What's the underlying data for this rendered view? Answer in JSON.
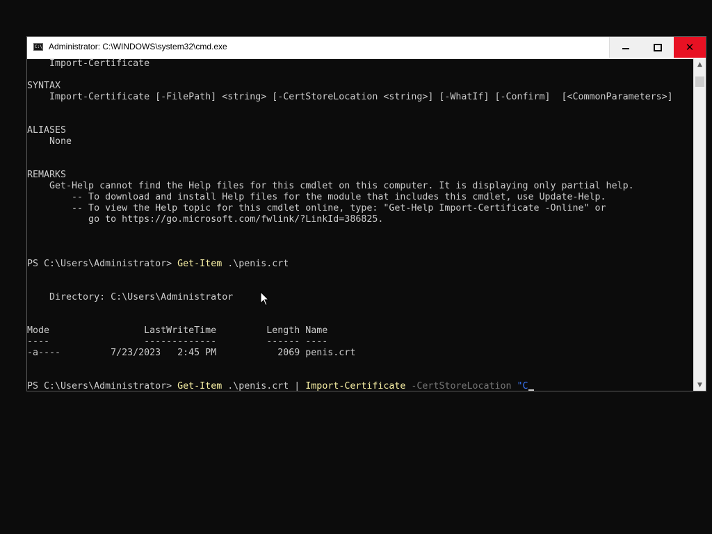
{
  "window": {
    "title": "Administrator: C:\\WINDOWS\\system32\\cmd.exe",
    "icon_label": "C:\\",
    "buttons": {
      "minimize": "minimize",
      "maximize": "maximize",
      "close": "close"
    }
  },
  "console": {
    "lines": [
      "    Import-Certificate",
      "",
      "SYNTAX",
      "    Import-Certificate [-FilePath] <string> [-CertStoreLocation <string>] [-WhatIf] [-Confirm]  [<CommonParameters>]",
      "",
      "",
      "ALIASES",
      "    None",
      "",
      "",
      "REMARKS",
      "    Get-Help cannot find the Help files for this cmdlet on this computer. It is displaying only partial help.",
      "        -- To download and install Help files for the module that includes this cmdlet, use Update-Help.",
      "        -- To view the Help topic for this cmdlet online, type: \"Get-Help Import-Certificate -Online\" or",
      "           go to https://go.microsoft.com/fwlink/?LinkId=386825.",
      "",
      "",
      "",
      "",
      "",
      "",
      "    Directory: C:\\Users\\Administrator",
      "",
      "",
      "Mode                 LastWriteTime         Length Name",
      "----                 -------------         ------ ----",
      "-a----         7/23/2023   2:45 PM           2069 penis.crt"
    ],
    "prompt1": {
      "prompt": "PS C:\\Users\\Administrator> ",
      "cmd": "Get-Item",
      "arg": " .\\penis.crt"
    },
    "prompt2": {
      "prompt": "PS C:\\Users\\Administrator> ",
      "cmd1": "Get-Item",
      "arg1": " .\\penis.crt | ",
      "cmd2": "Import-Certificate",
      "param": " -CertStoreLocation ",
      "str": "\"C"
    }
  },
  "colors": {
    "background": "#0c0c0c",
    "text": "#cccccc",
    "command": "#f9f1a5",
    "parameter": "#767676",
    "string": "#3b78ff",
    "close_button": "#e81123"
  }
}
